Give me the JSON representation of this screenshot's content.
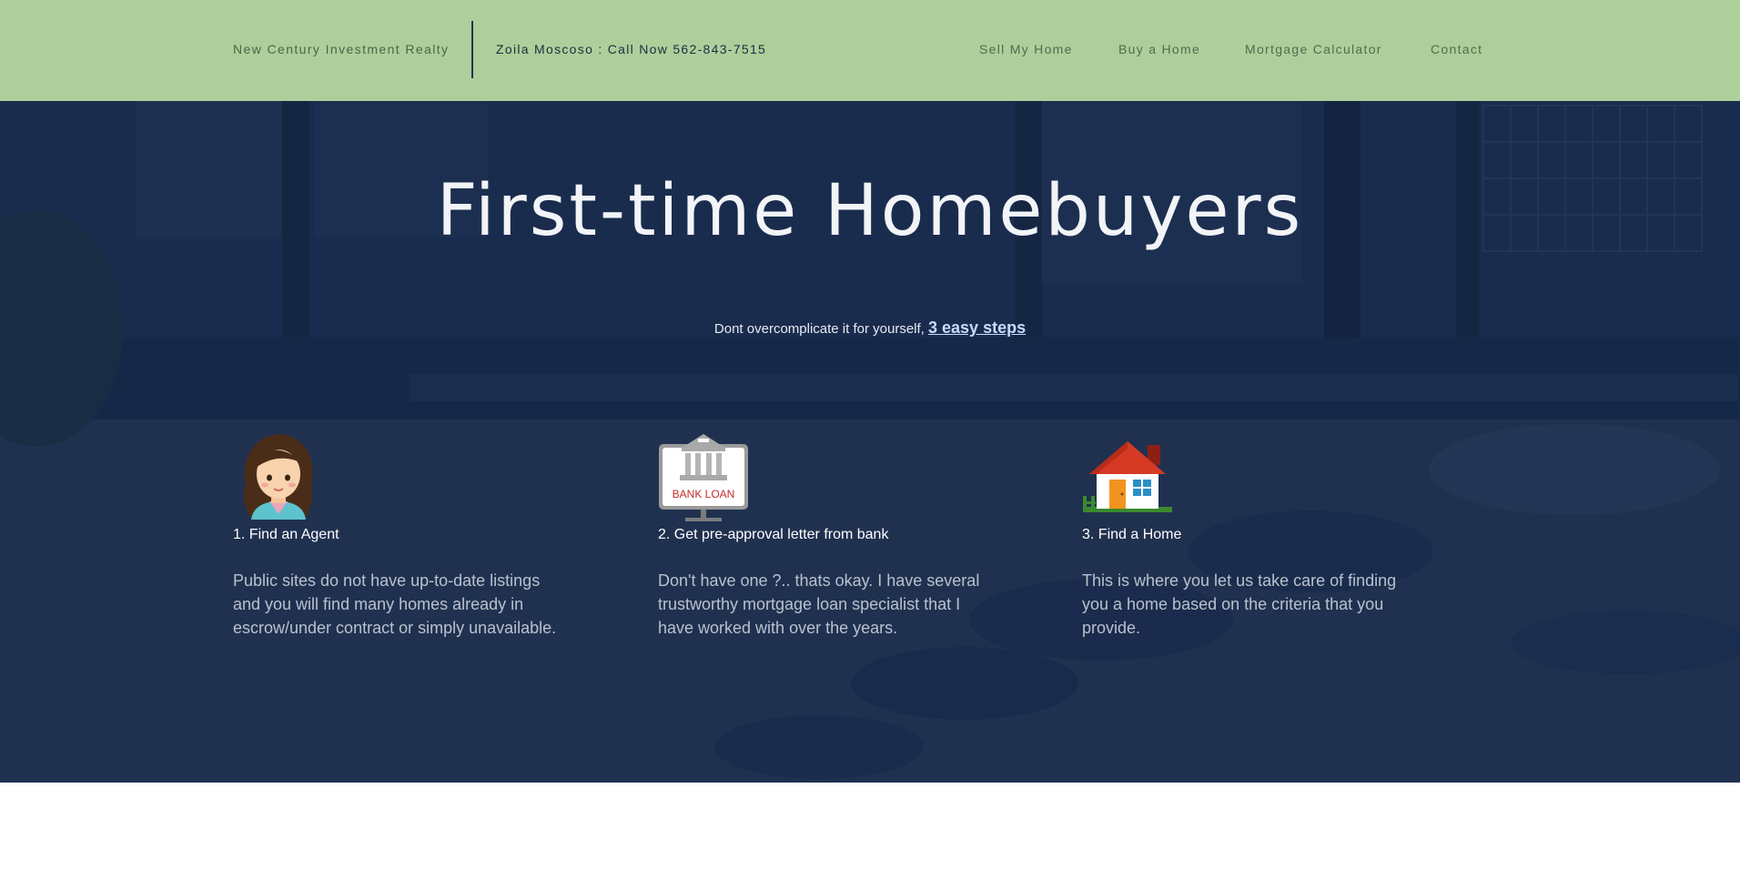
{
  "header": {
    "brand": "New Century Investment Realty",
    "phone": "Zoila Moscoso : Call Now 562-843-7515",
    "nav": [
      "Sell My Home",
      "Buy a Home",
      "Mortgage Calculator",
      "Contact"
    ]
  },
  "hero": {
    "title": "First-time Homebuyers",
    "subtitle_prefix": "Dont overcomplicate it for yourself,",
    "subtitle_link": "3 easy steps"
  },
  "steps": [
    {
      "title": "1. Find an Agent",
      "text": "Public sites do not have up-to-date listings and you will find many homes already in escrow/under contract or simply unavailable.",
      "icon": "agent-icon"
    },
    {
      "title": "2. Get pre-approval letter from bank",
      "text": "Don't have one ?.. thats okay. I have several trustworthy mortgage loan specialist that I have worked with over the years.",
      "icon": "bank-loan-icon",
      "icon_text": "BANK LOAN"
    },
    {
      "title": "3. Find a Home",
      "text": "This is where you let us take care of finding you a home based on the criteria that you provide.",
      "icon": "house-icon"
    }
  ],
  "colors": {
    "header_bg": "#aecf9b",
    "hero_overlay": "#162848",
    "link": "#c9d9ff"
  }
}
